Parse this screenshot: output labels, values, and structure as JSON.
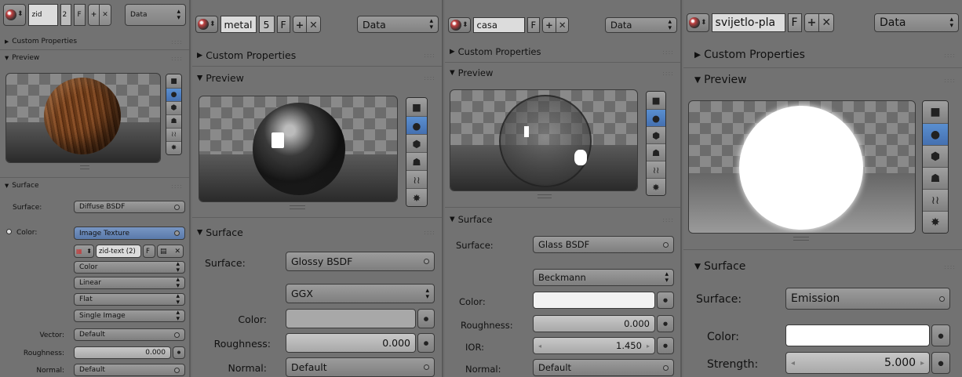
{
  "panel1": {
    "name": "zid",
    "users": "2",
    "fake": "F",
    "data_selector": "Data",
    "sec_custom": "Custom Properties",
    "sec_preview": "Preview",
    "sec_surface": "Surface",
    "surface_label": "Surface:",
    "surface_value": "Diffuse BSDF",
    "color_label": "Color:",
    "color_value": "Image Texture",
    "texture_name": "zid-text (2)",
    "texture_fake": "F",
    "tex_color": "Color",
    "tex_interp": "Linear",
    "tex_proj": "Flat",
    "tex_source": "Single Image",
    "vector_label": "Vector:",
    "vector_value": "Default",
    "roughness_label": "Roughness:",
    "roughness_value": "0.000",
    "normal_label": "Normal:",
    "normal_value": "Default"
  },
  "panel2": {
    "name": "metal",
    "users": "5",
    "fake": "F",
    "data_selector": "Data",
    "sec_custom": "Custom Properties",
    "sec_preview": "Preview",
    "sec_surface": "Surface",
    "surface_label": "Surface:",
    "surface_value": "Glossy BSDF",
    "distribution": "GGX",
    "color_label": "Color:",
    "roughness_label": "Roughness:",
    "roughness_value": "0.000",
    "normal_label": "Normal:",
    "normal_value": "Default"
  },
  "panel3": {
    "name": "casa",
    "fake": "F",
    "data_selector": "Data",
    "sec_custom": "Custom Properties",
    "sec_preview": "Preview",
    "sec_surface": "Surface",
    "surface_label": "Surface:",
    "surface_value": "Glass BSDF",
    "distribution": "Beckmann",
    "color_label": "Color:",
    "roughness_label": "Roughness:",
    "roughness_value": "0.000",
    "ior_label": "IOR:",
    "ior_value": "1.450",
    "normal_label": "Normal:",
    "normal_value": "Default"
  },
  "panel4": {
    "name": "svijetlo-pla",
    "fake": "F",
    "data_selector": "Data",
    "sec_custom": "Custom Properties",
    "sec_preview": "Preview",
    "sec_surface": "Surface",
    "surface_label": "Surface:",
    "surface_value": "Emission",
    "color_label": "Color:",
    "strength_label": "Strength:",
    "strength_value": "5.000"
  },
  "icons": {
    "material": "material-ball-icon",
    "plus": "plus-icon",
    "close": "close-x-icon",
    "preview_types": [
      "flat-plane-icon",
      "sphere-icon",
      "cube-icon",
      "monkey-icon",
      "hair-icon",
      "world-sphere-icon"
    ]
  },
  "colors": {
    "selected_blue": "#4a78b8",
    "panel_bg": "#727272",
    "white_swatch": "#f4f4f4"
  }
}
